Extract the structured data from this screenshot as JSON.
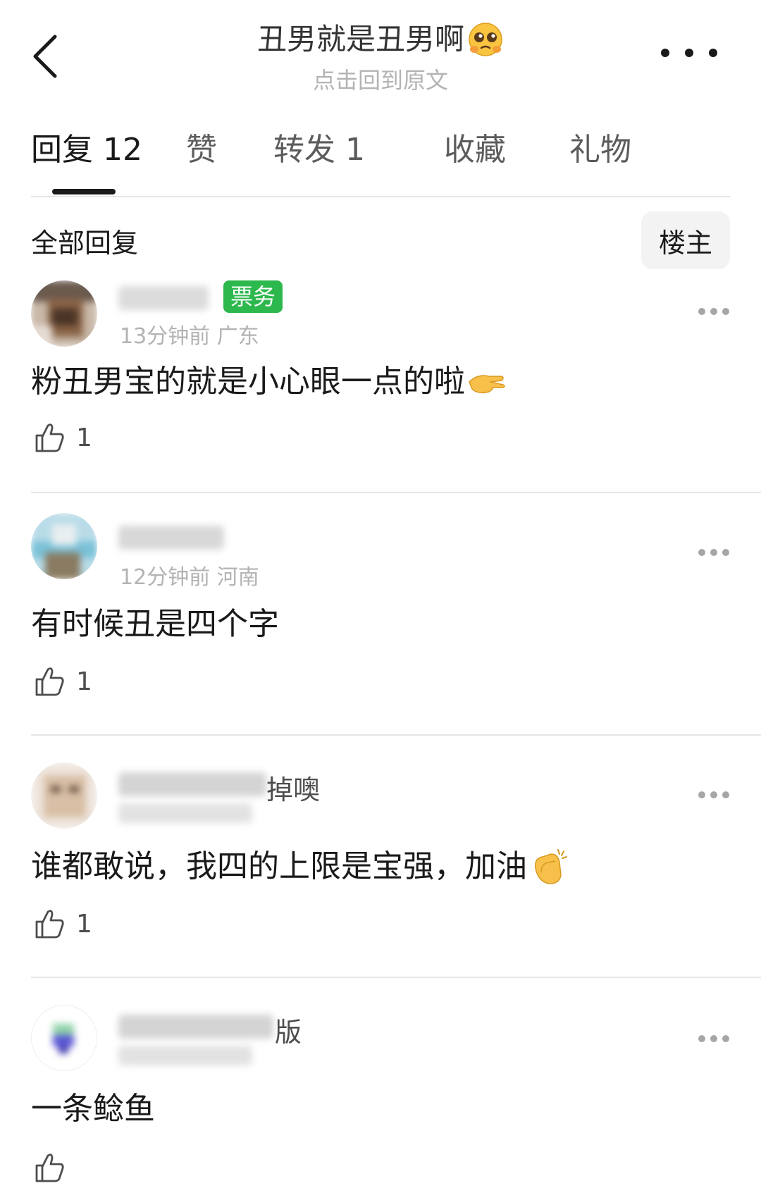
{
  "header": {
    "title": "丑男就是丑男啊",
    "subtitle": "点击回到原文",
    "title_emoji": "pleading-face-emoji"
  },
  "tabs": [
    {
      "label": "回复",
      "count": "12"
    },
    {
      "label": "赞",
      "count": ""
    },
    {
      "label": "转发",
      "count": "1"
    },
    {
      "label": "收藏",
      "count": ""
    },
    {
      "label": "礼物",
      "count": ""
    }
  ],
  "section": {
    "title": "全部回复",
    "filter_label": "楼主"
  },
  "comments": [
    {
      "name_visible": "",
      "badge": "票务",
      "meta": "13分钟前 广东",
      "text": "粉丑男宝的就是小心眼一点的啦",
      "emoji": "pinching-hand-emoji",
      "likes": "1"
    },
    {
      "name_visible": "",
      "meta": "12分钟前 河南",
      "text": "有时候丑是四个字",
      "likes": "1"
    },
    {
      "name_visible": "掉噢",
      "text": "谁都敢说，我四的上限是宝强，加油",
      "emoji": "clapping-hands-emoji",
      "likes": "1"
    },
    {
      "name_visible": "版",
      "text": "一条鲶鱼",
      "likes": ""
    }
  ],
  "colors": {
    "badge_green": "#2db84d",
    "text_primary": "#1a1a1a",
    "text_secondary": "#b3b3b3",
    "divider": "#e6e6e6"
  }
}
